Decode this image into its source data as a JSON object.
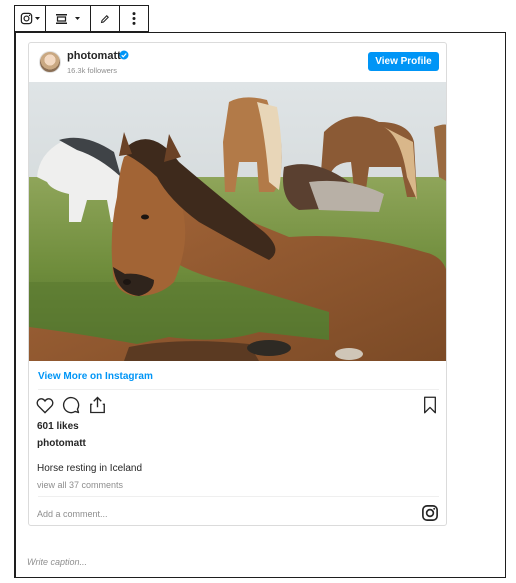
{
  "toolbar": {
    "icons": [
      "instagram-icon",
      "chevron-down-icon",
      "align-icon",
      "chevron-down-icon",
      "pencil-icon",
      "more-vertical-icon"
    ]
  },
  "post": {
    "username": "photomatt",
    "followers": "16.3k followers",
    "view_profile_label": "View Profile",
    "view_more_label": "View More on Instagram",
    "likes": "601 likes",
    "owner": "photomatt",
    "caption": "Horse resting in Iceland",
    "comments_link": "view all 37 comments",
    "add_comment_placeholder": "Add a comment..."
  },
  "block": {
    "caption_placeholder": "Write caption..."
  },
  "colors": {
    "accent": "#0095f6",
    "muted_text": "#8e8e8e",
    "border": "#dbdbdb"
  }
}
